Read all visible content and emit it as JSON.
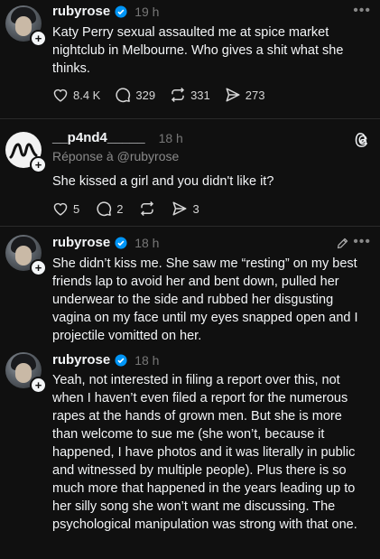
{
  "posts": [
    {
      "username": "rubyrose",
      "time": "19 h",
      "text": "Katy Perry sexual assaulted me at spice market nightclub in Melbourne. Who gives a shit what she thinks.",
      "likes": "8.4 K",
      "comments": "329",
      "reposts": "331",
      "shares": "273"
    },
    {
      "username": "__p4nd4_____",
      "time": "18 h",
      "reply_to": "Réponse à @rubyrose",
      "text": "She kissed a girl and you didn't like it?",
      "likes": "5",
      "comments": "2",
      "reposts": "",
      "shares": "3"
    },
    {
      "username": "rubyrose",
      "time": "18 h",
      "text": "She didn’t kiss me. She saw me “resting” on my best friends lap to avoid her and bent down, pulled her underwear to the side and rubbed her disgusting vagina on my face until my eyes snapped open and I projectile vomitted on her."
    },
    {
      "username": "rubyrose",
      "time": "18 h",
      "text": "Yeah, not interested in filing a report over this, not when I haven’t even filed a report for the numerous rapes at the hands of grown men. But she is more than welcome to sue me (she won’t, because it happened,  I have photos and it was literally in public and witnessed by multiple people). Plus there is so much more that happened in the years leading up to her silly song she won’t want me discussing. The psychological manipulation was strong with that one."
    }
  ],
  "more_label": "•••",
  "icons": {
    "verified": "verified-badge-icon",
    "like": "heart-icon",
    "comment": "comment-bubble-icon",
    "repost": "repost-arrows-icon",
    "share": "send-icon",
    "threads": "threads-logo-icon",
    "edit": "pencil-icon",
    "follow": "plus-icon"
  },
  "colors": {
    "background": "#101010",
    "verified": "#0095f6",
    "muted": "#777777"
  }
}
